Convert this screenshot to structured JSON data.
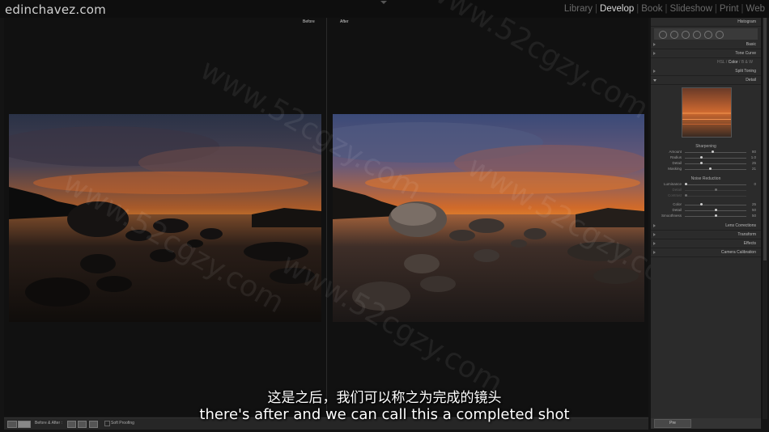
{
  "app": {
    "logo": "edinchavez.com",
    "modules": [
      "Library",
      "Develop",
      "Book",
      "Slideshow",
      "Print",
      "Web"
    ],
    "active_module": "Develop"
  },
  "view": {
    "before_label": "Before",
    "after_label": "After"
  },
  "toolbar": {
    "mode_label": "Before & After :",
    "soft_proofing_label": "Soft Proofing"
  },
  "panel": {
    "histogram_label": "Histogram",
    "sections": [
      {
        "label": "Basic",
        "open": false
      },
      {
        "label": "Tone Curve",
        "open": false
      },
      {
        "label": "Split Toning",
        "open": false
      },
      {
        "label": "Detail",
        "open": true
      },
      {
        "label": "Lens Corrections",
        "open": false
      },
      {
        "label": "Transform",
        "open": false
      },
      {
        "label": "Effects",
        "open": false
      },
      {
        "label": "Camera Calibration",
        "open": false
      }
    ],
    "hsl_tabs": [
      "HSL",
      "Color",
      "B & W"
    ],
    "sharpening": {
      "title": "Sharpening",
      "sliders": [
        {
          "name": "Amount",
          "value": "80",
          "pos": 0.45
        },
        {
          "name": "Radius",
          "value": "1.0",
          "pos": 0.25
        },
        {
          "name": "Detail",
          "value": "25",
          "pos": 0.25
        },
        {
          "name": "Masking",
          "value": "21",
          "pos": 0.4
        }
      ]
    },
    "noise_reduction": {
      "title": "Noise Reduction",
      "sliders": [
        {
          "name": "Luminance",
          "value": "0",
          "pos": 0.0
        },
        {
          "name": "Detail",
          "value": "",
          "pos": 0.5
        },
        {
          "name": "Contrast",
          "value": "",
          "pos": 0.0
        },
        {
          "name": "Color",
          "value": "25",
          "pos": 0.25
        },
        {
          "name": "Detail",
          "value": "50",
          "pos": 0.5
        },
        {
          "name": "Smoothness",
          "value": "50",
          "pos": 0.5
        }
      ]
    },
    "bottom_button": "Pre"
  },
  "watermark": "www.52cgzy.com",
  "subtitles": {
    "zh": "这是之后，我们可以称之为完成的镜头",
    "en": "there's after and we can call this a completed shot"
  }
}
